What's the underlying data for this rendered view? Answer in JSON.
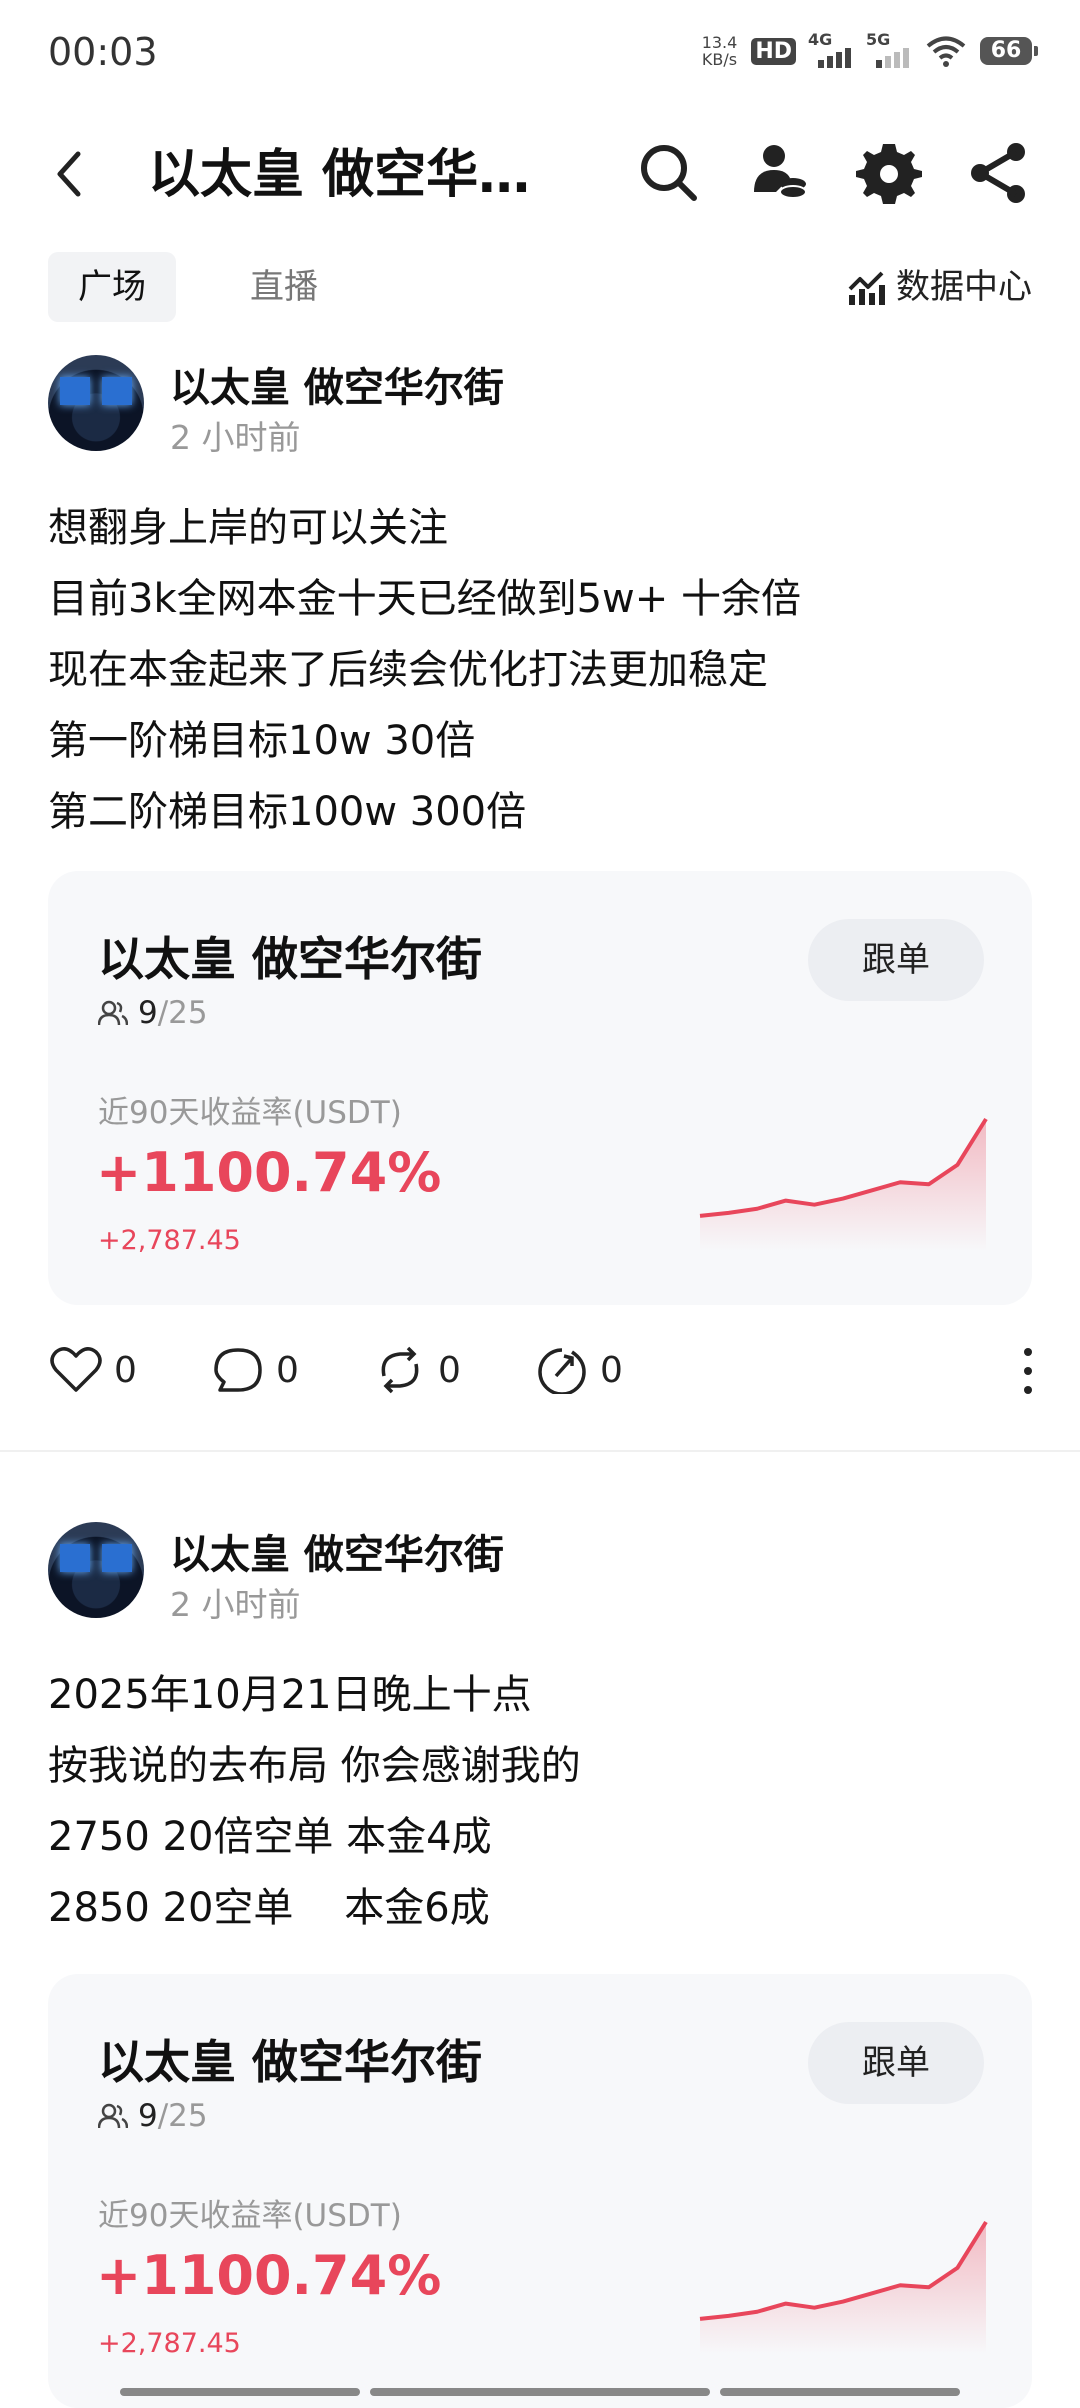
{
  "status_bar": {
    "time": "00:03",
    "net_speed_value": "13.4",
    "net_speed_unit": "KB/s",
    "hd_label": "HD",
    "sim1_label": "4G",
    "sim2_label": "5G",
    "battery": "66"
  },
  "header": {
    "title": "以太皇 做空华…",
    "icons": [
      "back-arrow-icon",
      "search-icon",
      "user-coin-icon",
      "gear-icon",
      "share-icon"
    ]
  },
  "tabs": [
    {
      "label": "广场",
      "active": true
    },
    {
      "label": "直播",
      "active": false
    }
  ],
  "data_center_label": "数据中心",
  "posts": [
    {
      "author": "以太皇 做空华尔街",
      "time": "2 小时前",
      "lines": [
        "想翻身上岸的可以关注",
        "目前3k全网本金十天已经做到5w+ 十余倍",
        "现在本金起来了后续会优化打法更加稳定",
        "第一阶梯目标10w 30倍",
        "第二阶梯目标100w 300倍"
      ],
      "card": {
        "name": "以太皇 做空华尔街",
        "follow_label": "跟单",
        "members_current": "9",
        "members_total": "/25",
        "return_label": "近90天收益率(USDT)",
        "return_pct": "+1100.74%",
        "return_abs": "+2,787.45",
        "sparkline": [
          0.05,
          0.08,
          0.12,
          0.2,
          0.16,
          0.22,
          0.3,
          0.38,
          0.36,
          0.55,
          1.0
        ]
      },
      "actions": {
        "like": "0",
        "comment": "0",
        "repost": "0",
        "share": "0"
      }
    },
    {
      "author": "以太皇 做空华尔街",
      "time": "2 小时前",
      "lines": [
        "2025年10月21日晚上十点",
        "按我说的去布局 你会感谢我的",
        "2750 20倍空单 本金4成",
        "2850 20空单    本金6成"
      ],
      "card": {
        "name": "以太皇 做空华尔街",
        "follow_label": "跟单",
        "members_current": "9",
        "members_total": "/25",
        "return_label": "近90天收益率(USDT)",
        "return_pct": "+1100.74%",
        "return_abs": "+2,787.45",
        "sparkline": [
          0.05,
          0.08,
          0.12,
          0.2,
          0.16,
          0.22,
          0.3,
          0.38,
          0.36,
          0.55,
          1.0
        ]
      }
    }
  ],
  "colors": {
    "accent_red": "#e8465b",
    "card_bg": "#f7f8fa",
    "muted": "#999999"
  }
}
